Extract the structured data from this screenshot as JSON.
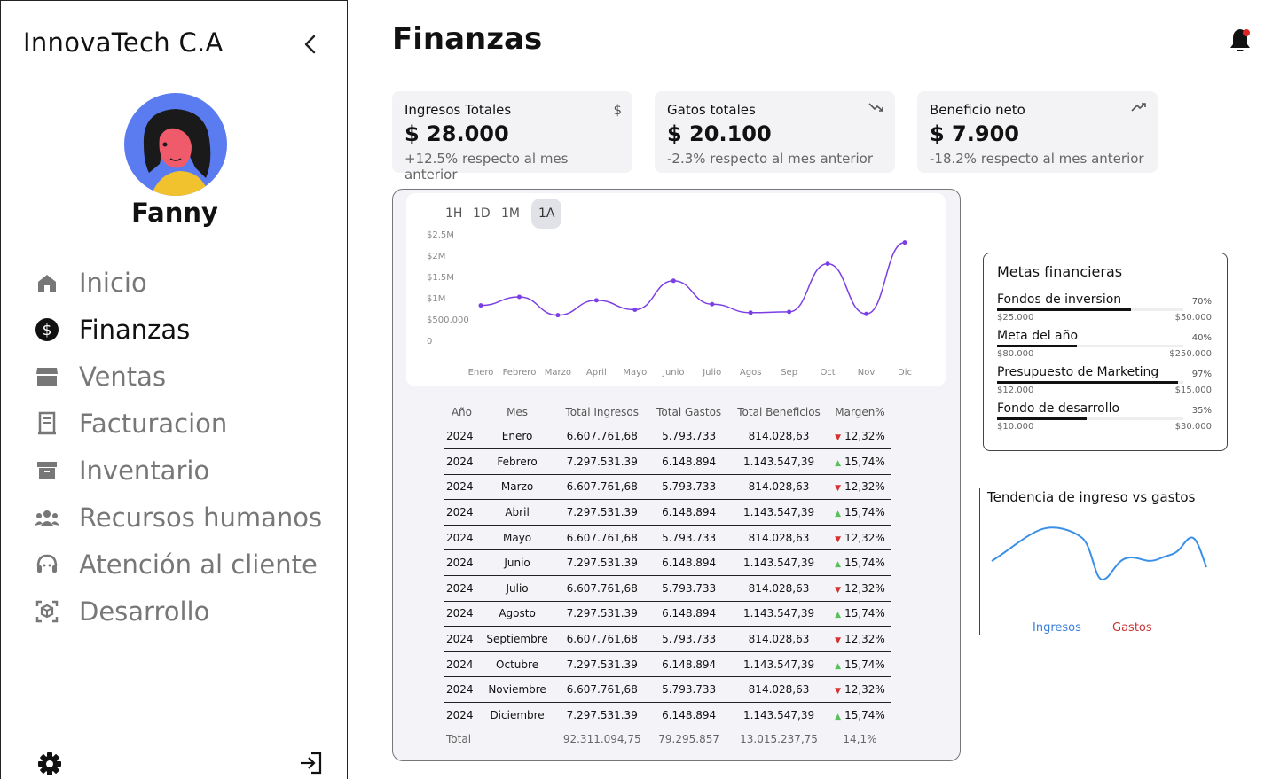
{
  "sidebar": {
    "company": "InnovaTech C.A",
    "username": "Fanny",
    "nav": [
      {
        "label": "Inicio",
        "icon": "home-icon"
      },
      {
        "label": "Finanzas",
        "icon": "dollar-icon",
        "active": true
      },
      {
        "label": "Ventas",
        "icon": "store-icon"
      },
      {
        "label": "Facturacion",
        "icon": "receipt-icon"
      },
      {
        "label": "Inventario",
        "icon": "archive-icon"
      },
      {
        "label": "Recursos humanos",
        "icon": "people-icon"
      },
      {
        "label": "Atención al cliente",
        "icon": "support-icon"
      },
      {
        "label": "Desarrollo",
        "icon": "cube-icon"
      }
    ]
  },
  "header": {
    "title": "Finanzas"
  },
  "kpis": [
    {
      "label": "Ingresos Totales",
      "value": "$ 28.000",
      "note": "+12.5% respecto al mes anterior",
      "icon": "dollar-sign-icon"
    },
    {
      "label": "Gatos totales",
      "value": "$ 20.100",
      "note": "-2.3% respecto al mes anterior",
      "icon": "trending-down-icon"
    },
    {
      "label": "Beneficio neto",
      "value": "$ 7.900",
      "note": "-18.2% respecto al mes anterior",
      "icon": "trending-up-icon"
    }
  ],
  "timeframes": [
    "1H",
    "1D",
    "1M",
    "1A"
  ],
  "active_timeframe": "1A",
  "chart_data": {
    "type": "line",
    "categories": [
      "Enero",
      "Febrero",
      "Marzo",
      "April",
      "Mayo",
      "Junio",
      "Julio",
      "Agos",
      "Sep",
      "Oct",
      "Nov",
      "Dic"
    ],
    "values": [
      820000,
      1020000,
      590000,
      940000,
      720000,
      1400000,
      850000,
      650000,
      670000,
      1800000,
      620000,
      2300000
    ],
    "yticks": [
      "0",
      "$500,000",
      "$1M",
      "$1.5M",
      "$2M",
      "$2.5M"
    ],
    "ylim": [
      0,
      2500000
    ],
    "color": "#7b3fe4"
  },
  "table": {
    "headers": [
      "Año",
      "Mes",
      "Total Ingresos",
      "Total Gastos",
      "Total Beneficios",
      "Margen%"
    ],
    "rows": [
      [
        "2024",
        "Enero",
        "6.607.761,68",
        "5.793.733",
        "814.028,63",
        "12,32%",
        "down"
      ],
      [
        "2024",
        "Febrero",
        "7.297.531.39",
        "6.148.894",
        "1.143.547,39",
        "15,74%",
        "up"
      ],
      [
        "2024",
        "Marzo",
        "6.607.761,68",
        "5.793.733",
        "814.028,63",
        "12,32%",
        "down"
      ],
      [
        "2024",
        "Abril",
        "7.297.531.39",
        "6.148.894",
        "1.143.547,39",
        "15,74%",
        "up"
      ],
      [
        "2024",
        "Mayo",
        "6.607.761,68",
        "5.793.733",
        "814.028,63",
        "12,32%",
        "down"
      ],
      [
        "2024",
        "Junio",
        "7.297.531.39",
        "6.148.894",
        "1.143.547,39",
        "15,74%",
        "up"
      ],
      [
        "2024",
        "Julio",
        "6.607.761,68",
        "5.793.733",
        "814.028,63",
        "12,32%",
        "down"
      ],
      [
        "2024",
        "Agosto",
        "7.297.531.39",
        "6.148.894",
        "1.143.547,39",
        "15,74%",
        "up"
      ],
      [
        "2024",
        "Septiembre",
        "6.607.761,68",
        "5.793.733",
        "814.028,63",
        "12,32%",
        "down"
      ],
      [
        "2024",
        "Octubre",
        "7.297.531.39",
        "6.148.894",
        "1.143.547,39",
        "15,74%",
        "up"
      ],
      [
        "2024",
        "Noviembre",
        "6.607.761,68",
        "5.793.733",
        "814.028,63",
        "12,32%",
        "down"
      ],
      [
        "2024",
        "Diciembre",
        "7.297.531.39",
        "6.148.894",
        "1.143.547,39",
        "15,74%",
        "up"
      ]
    ],
    "total": [
      "Total",
      "",
      "92.311.094,75",
      "79.295.857",
      "13.015.237,75",
      "14,1%"
    ]
  },
  "goals": {
    "title": "Metas financieras",
    "items": [
      {
        "name": "Fondos de inversion",
        "pct": "70%",
        "fill": 0.72,
        "min": "$25.000",
        "max": "$50.000"
      },
      {
        "name": "Meta del año",
        "pct": "40%",
        "fill": 0.43,
        "min": "$80.000",
        "max": "$250.000"
      },
      {
        "name": "Presupuesto de Marketing",
        "pct": "97%",
        "fill": 0.97,
        "min": "$12.000",
        "max": "$15.000"
      },
      {
        "name": "Fondo de desarrollo",
        "pct": "35%",
        "fill": 0.48,
        "min": "$10.000",
        "max": "$30.000"
      }
    ]
  },
  "trend": {
    "title": "Tendencia de ingreso vs gastos",
    "legend_ingresos": "Ingresos",
    "legend_gastos": "Gastos",
    "color": "#3a8fe8"
  }
}
